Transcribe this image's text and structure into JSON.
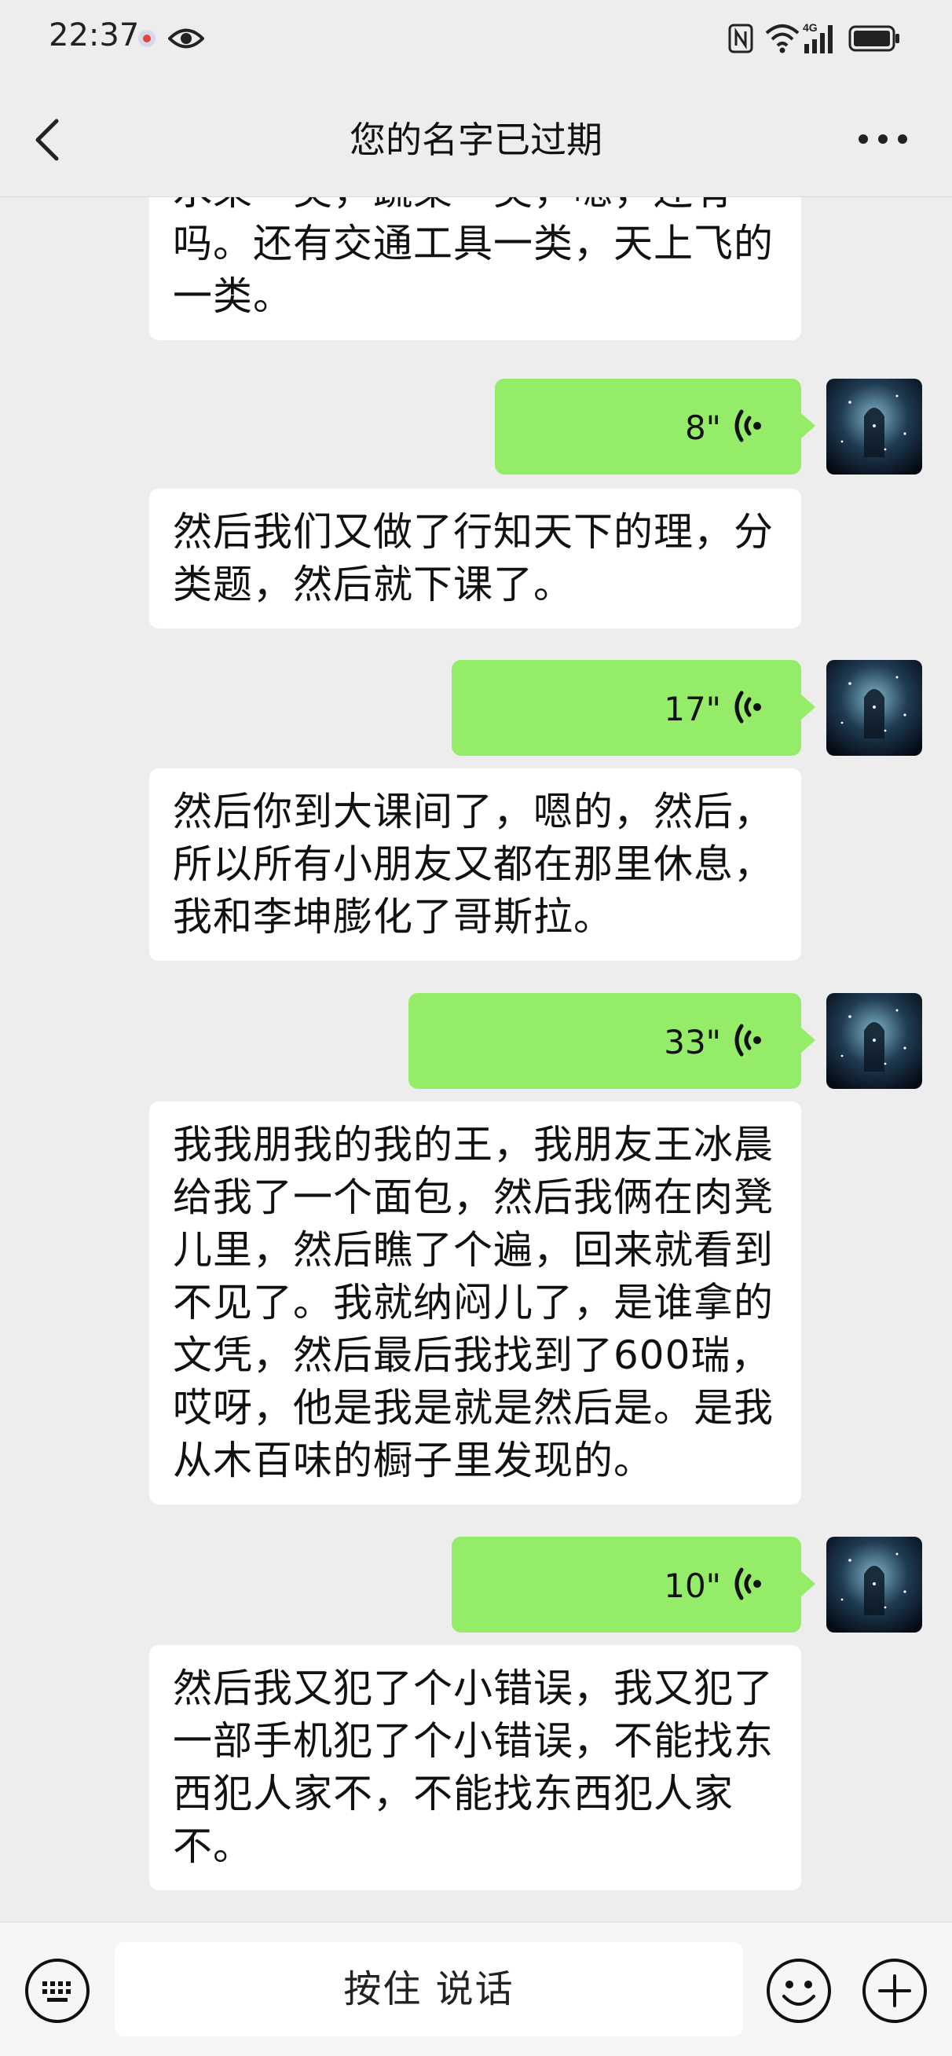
{
  "status_bar": {
    "time": "22:37",
    "icons": [
      "record-icon",
      "eye-icon",
      "nfc-icon",
      "wifi-icon",
      "signal-4g-icon",
      "battery-icon"
    ],
    "network_label": "4G"
  },
  "header": {
    "title": "您的名字已过期",
    "back_icon": "back-chevron-icon",
    "more_icon": "more-dots-icon"
  },
  "messages": [
    {
      "type": "incoming_text",
      "text": "水果一类，蔬菜一类，嗯，还有吗。还有交通工具一类，天上飞的一类。"
    },
    {
      "type": "outgoing_voice",
      "duration": "8\""
    },
    {
      "type": "incoming_text",
      "text": "然后我们又做了行知天下的理，分类题，然后就下课了。"
    },
    {
      "type": "outgoing_voice",
      "duration": "17\""
    },
    {
      "type": "incoming_text",
      "text": "然后你到大课间了，嗯的，然后，所以所有小朋友又都在那里休息，我和李坤膨化了哥斯拉。"
    },
    {
      "type": "outgoing_voice",
      "duration": "33\""
    },
    {
      "type": "incoming_text",
      "text": "我我朋我的我的王，我朋友王冰晨给我了一个面包，然后我俩在肉凳儿里，然后瞧了个遍，回来就看到不见了。我就纳闷儿了，是谁拿的文凭，然后最后我找到了600瑞，哎呀，他是我是就是然后是。是我从木百味的橱子里发现的。"
    },
    {
      "type": "outgoing_voice",
      "duration": "10\""
    },
    {
      "type": "incoming_text",
      "text": "然后我又犯了个小错误，我又犯了一部手机犯了个小错误，不能找东西犯人家不，不能找东西犯人家不。"
    }
  ],
  "input_bar": {
    "hold_to_talk": "按住 说话",
    "left_icon": "keyboard-icon",
    "emoji_icon": "emoji-icon",
    "plus_icon": "plus-icon"
  },
  "colors": {
    "background": "#ededed",
    "outgoing_bubble": "#95ec69",
    "incoming_bubble": "#ffffff"
  }
}
